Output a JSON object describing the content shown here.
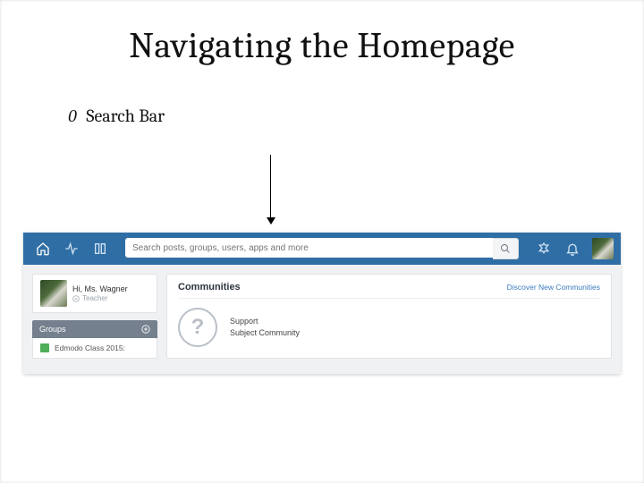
{
  "slide": {
    "title": "Navigating the Homepage",
    "bullet_marker": "0",
    "bullet_text": "Search Bar"
  },
  "topbar": {
    "search_placeholder": "Search posts, groups, users, apps and more"
  },
  "profile": {
    "greeting": "Hi, Ms. Wagner",
    "role": "Teacher"
  },
  "groups": {
    "header": "Groups",
    "item": "Edmodo Class 2015:"
  },
  "main": {
    "title": "Communities",
    "discover": "Discover New Communities",
    "line1": "Support",
    "line2": "Subject Community"
  }
}
